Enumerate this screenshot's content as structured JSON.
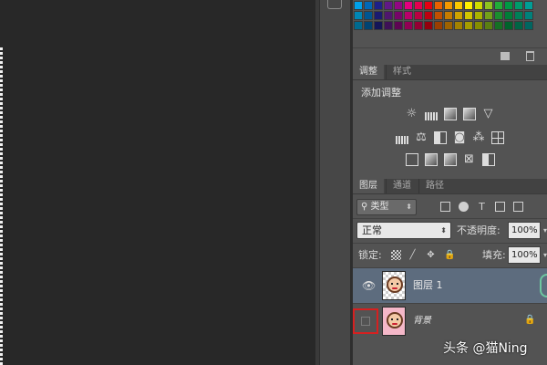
{
  "colors": {
    "canvas": "#282828",
    "panel": "#535353",
    "layer_selected": "#5d6c7e",
    "highlight_box": "#d62020"
  },
  "swatch_rows": [
    [
      "#00a0e9",
      "#0068b7",
      "#1d2088",
      "#601986",
      "#920783",
      "#e4007f",
      "#e5004f",
      "#e60012",
      "#eb6100",
      "#f39800",
      "#fcc800",
      "#fff100",
      "#cfdb00",
      "#8fc31f",
      "#22ac38",
      "#009944",
      "#009b6b",
      "#009e96"
    ],
    [
      "#0086b5",
      "#005591",
      "#1a1a70",
      "#4f166e",
      "#770569",
      "#b9006a",
      "#ba0041",
      "#bc000f",
      "#c14f00",
      "#c77c00",
      "#cea300",
      "#d1c600",
      "#a9b300",
      "#74a019",
      "#1b8d2e",
      "#007d38",
      "#007f58",
      "#00817b"
    ],
    [
      "#006a8f",
      "#004372",
      "#141558",
      "#3e1157",
      "#5e0453",
      "#920054",
      "#930033",
      "#94000c",
      "#993e00",
      "#9d6200",
      "#a28100",
      "#a59c00",
      "#858d00",
      "#5b7e13",
      "#157024",
      "#00632c",
      "#006445",
      "#006661"
    ]
  ],
  "adjustments": {
    "tab_adjust": "调整",
    "tab_style": "样式",
    "title": "添加调整",
    "row1": [
      {
        "icon": "brightness-icon",
        "glyph": "☼"
      },
      {
        "icon": "levels-icon",
        "glyph": ""
      },
      {
        "icon": "curves-icon",
        "glyph": ""
      },
      {
        "icon": "exposure-icon",
        "glyph": ""
      },
      {
        "icon": "vibrance-icon",
        "glyph": "▽"
      }
    ],
    "row2": [
      {
        "icon": "hue-saturation-icon",
        "glyph": ""
      },
      {
        "icon": "color-balance-icon",
        "glyph": "⚖"
      },
      {
        "icon": "black-white-icon",
        "glyph": ""
      },
      {
        "icon": "photo-filter-icon",
        "glyph": "◙"
      },
      {
        "icon": "channel-mixer-icon",
        "glyph": "⁂"
      },
      {
        "icon": "color-lookup-icon",
        "glyph": ""
      }
    ],
    "row3": [
      {
        "icon": "invert-icon",
        "glyph": ""
      },
      {
        "icon": "posterize-icon",
        "glyph": ""
      },
      {
        "icon": "threshold-icon",
        "glyph": ""
      },
      {
        "icon": "selective-color-icon",
        "glyph": "⊠"
      },
      {
        "icon": "gradient-map-icon",
        "glyph": ""
      }
    ]
  },
  "layers": {
    "tab_layers": "图层",
    "tab_channels": "通道",
    "tab_paths": "路径",
    "filter_kind": "类型",
    "blend_mode": "正常",
    "opacity_label": "不透明度:",
    "opacity_value": "100%",
    "lock_label": "锁定:",
    "fill_label": "填充:",
    "fill_value": "100%",
    "items": [
      {
        "name": "图层 1",
        "visible": true,
        "selected": true
      },
      {
        "name": "背景",
        "visible": false,
        "selected": false,
        "locked": true
      }
    ]
  },
  "watermark": "头条 @猫Ning"
}
